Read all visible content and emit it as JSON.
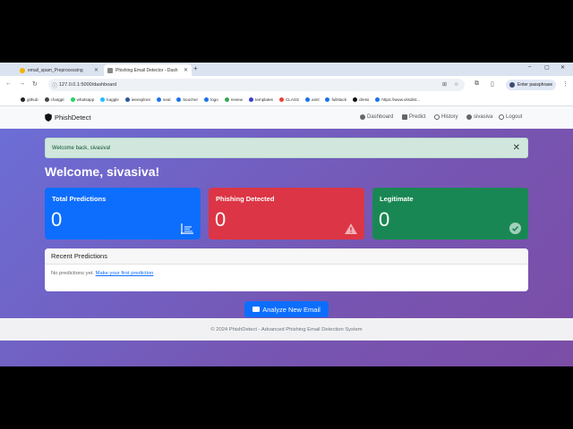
{
  "browser": {
    "tabs": [
      {
        "title": "email_spam_Preprocessing",
        "color": "#f4b400"
      },
      {
        "title": "Phishing Email Detector - Dash",
        "color": "#555"
      }
    ],
    "new_tab": "+",
    "window_controls": [
      "‒",
      "▢",
      "✕"
    ],
    "nav": {
      "back": "←",
      "forward": "→",
      "reload": "↻"
    },
    "url": "127.0.0.1:5000/dashboard",
    "passphrase_button": "Enter passphrase",
    "bookmarks": [
      {
        "label": "github",
        "color": "#222"
      },
      {
        "label": "chatgpt",
        "color": "#444"
      },
      {
        "label": "whatsapp",
        "color": "#25d366"
      },
      {
        "label": "kaggle",
        "color": "#20beff"
      },
      {
        "label": "ieeexplore",
        "color": "#2b5797"
      },
      {
        "label": "seal",
        "color": "#1a73e8"
      },
      {
        "label": "boucher",
        "color": "#1a73e8"
      },
      {
        "label": "logo",
        "color": "#1a73e8"
      },
      {
        "label": "review",
        "color": "#34a853"
      },
      {
        "label": "templates",
        "color": "#3b3bd1"
      },
      {
        "label": "CLASS",
        "color": "#ea4335"
      },
      {
        "label": "aiml",
        "color": "#1a73e8"
      },
      {
        "label": "fullstack",
        "color": "#1a73e8"
      },
      {
        "label": "dress",
        "color": "#111"
      },
      {
        "label": "https://www.vitsdist...",
        "color": "#1a73e8"
      }
    ]
  },
  "app": {
    "brand": "PhishDetect",
    "nav": {
      "dashboard": "Dashboard",
      "predict": "Predict",
      "history": "History",
      "user": "sivasiva",
      "logout": "Logout"
    },
    "alert": "Welcome back, sivasiva!",
    "alert_close": "✕",
    "welcome": "Welcome, sivasiva!",
    "cards": [
      {
        "title": "Total Predictions",
        "value": "0",
        "color": "#0d6efd",
        "icon": "bar-chart-icon"
      },
      {
        "title": "Phishing Detected",
        "value": "0",
        "color": "#dc3545",
        "icon": "warning-icon"
      },
      {
        "title": "Legitimate",
        "value": "0",
        "color": "#198754",
        "icon": "check-circle-icon"
      }
    ],
    "recent": {
      "title": "Recent Predictions",
      "empty_text": "No predictions yet.",
      "link": "Make your first prediction"
    },
    "analyze_button": "Analyze New Email",
    "footer": "© 2024 PhishDetect - Advanced Phishing Email Detection System"
  }
}
